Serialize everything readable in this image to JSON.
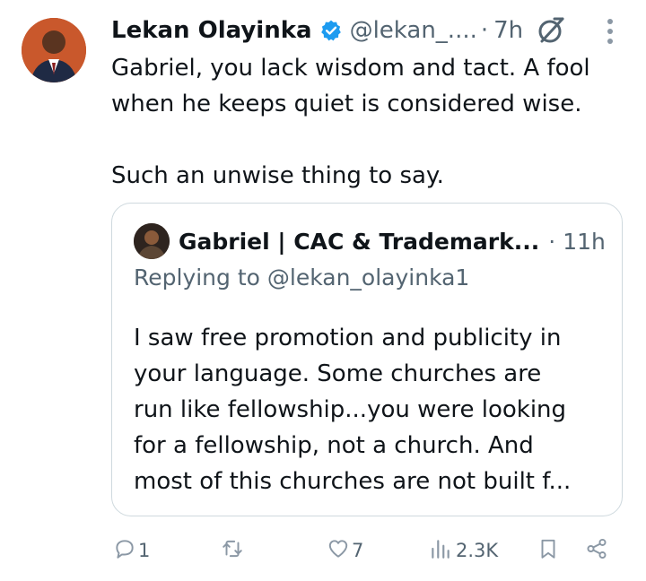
{
  "tweet": {
    "author": {
      "name": "Lekan Olayinka",
      "handle": "@lekan_....",
      "time": "7h",
      "separator": "·"
    },
    "text_lines": [
      "Gabriel, you lack wisdom and tact. A fool",
      "when he keeps quiet is considered wise."
    ],
    "text_line_2": "Such an unwise thing to say."
  },
  "quoted_tweet": {
    "author_name": "Gabriel | CAC & Trademark...",
    "separator": "·",
    "time": "11h",
    "replying_to": "Replying to @lekan_olayinka1",
    "text_lines": [
      "I saw free promotion and publicity in",
      "your language. Some churches are",
      "run like fellowship...you were looking",
      "for a fellowship, not a church. And",
      "most of this churches are not built f..."
    ]
  },
  "actions": {
    "reply_count": "1",
    "repost_count": "",
    "like_count": "7",
    "view_count": "2.3K"
  },
  "colors": {
    "verified_blue": "#1d9bf0",
    "muted_text": "#536471",
    "border": "#cfd9de",
    "action_icon": "#8b98a5"
  },
  "icons": {
    "verified": "verified-badge-icon",
    "grok": "grok-icon",
    "more": "more-vertical-icon",
    "reply": "reply-icon",
    "repost": "repost-icon",
    "like": "heart-icon",
    "views": "views-icon",
    "bookmark": "bookmark-icon",
    "share": "share-icon"
  }
}
